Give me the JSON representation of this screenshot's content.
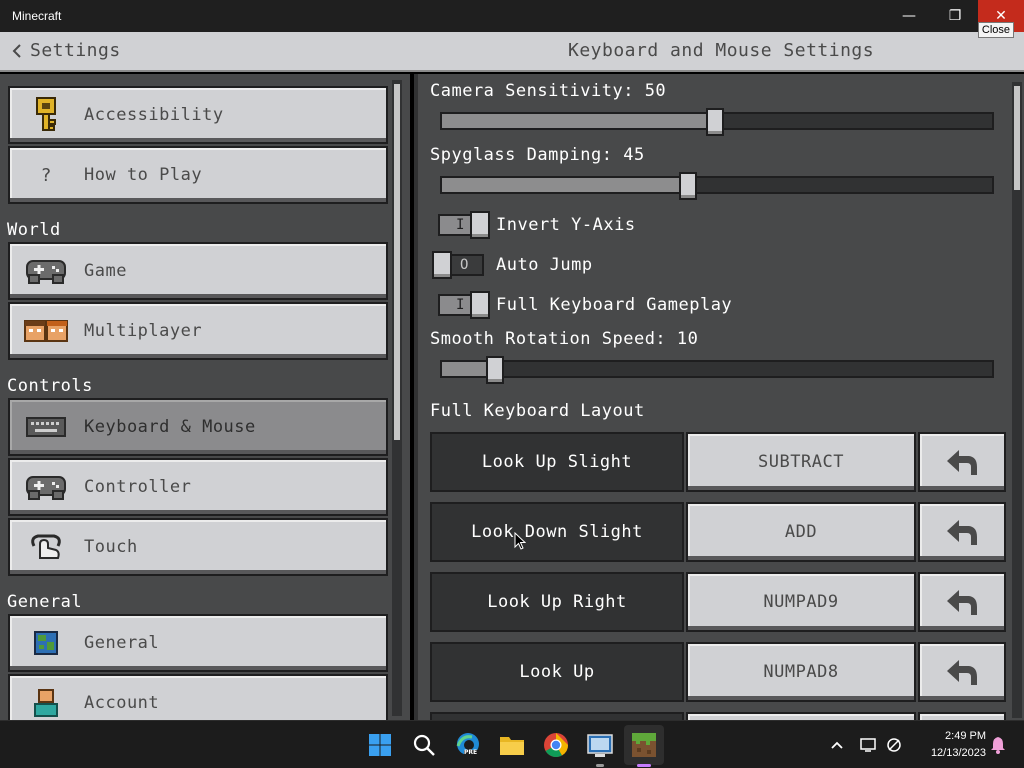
{
  "window": {
    "title": "Minecraft",
    "minimize_glyph": "—",
    "maximize_glyph": "❐",
    "close_glyph": "✕",
    "close_tooltip": "Close"
  },
  "header": {
    "back_label": "Settings",
    "page_title": "Keyboard and Mouse Settings"
  },
  "sidebar": {
    "items": [
      {
        "label": "Accessibility",
        "icon": "key-icon"
      },
      {
        "label": "How to Play",
        "icon": "question-icon",
        "glyph": "?"
      },
      {
        "label": "Game",
        "icon": "gamepad-icon"
      },
      {
        "label": "Multiplayer",
        "icon": "players-icon"
      },
      {
        "label": "Keyboard & Mouse",
        "icon": "keyboard-icon",
        "active": true
      },
      {
        "label": "Controller",
        "icon": "controller-icon"
      },
      {
        "label": "Touch",
        "icon": "touch-icon"
      },
      {
        "label": "General",
        "icon": "globe-icon"
      },
      {
        "label": "Account",
        "icon": "account-icon"
      }
    ],
    "sections": [
      "World",
      "Controls",
      "General"
    ]
  },
  "settings": {
    "camera_sensitivity": {
      "label": "Camera Sensitivity: 50",
      "value": 50,
      "min": 0,
      "max": 100
    },
    "spyglass_damping": {
      "label": "Spyglass Damping: 45",
      "value": 45,
      "min": 0,
      "max": 100
    },
    "invert_y": {
      "label": "Invert Y-Axis",
      "on": true,
      "mark": "I"
    },
    "auto_jump": {
      "label": "Auto Jump",
      "on": false,
      "mark": "O"
    },
    "full_keyboard": {
      "label": "Full Keyboard Gameplay",
      "on": true,
      "mark": "I"
    },
    "smooth_rotation": {
      "label": "Smooth Rotation Speed: 10",
      "value": 10,
      "min": 0,
      "max": 100
    },
    "layout_heading": "Full Keyboard Layout",
    "bindings": [
      {
        "action": "Look Up Slight",
        "key": "SUBTRACT"
      },
      {
        "action": "Look Down Slight",
        "key": "ADD"
      },
      {
        "action": "Look Up Right",
        "key": "NUMPAD9"
      },
      {
        "action": "Look Up",
        "key": "NUMPAD8"
      }
    ]
  },
  "taskbar": {
    "time": "2:49 PM",
    "date": "12/13/2023",
    "icons": [
      "windows-start-icon",
      "search-icon",
      "edge-preview-icon",
      "file-explorer-icon",
      "chrome-icon",
      "vista-app-icon",
      "minecraft-icon"
    ],
    "edge_badge": "PRE",
    "tray_chevron": "^"
  },
  "colors": {
    "panel": "#48494a",
    "button": "#d0d1d4",
    "button_active": "#8b8b8d",
    "dark": "#313233",
    "close_red": "#c42b1c"
  }
}
